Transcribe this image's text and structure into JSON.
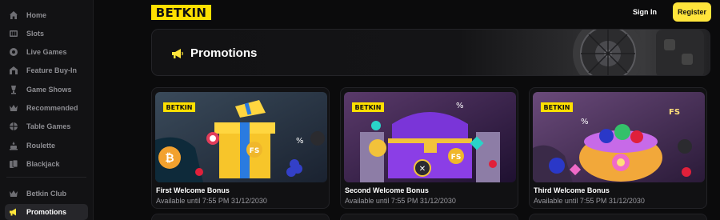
{
  "brand": {
    "logo_text": "BETKIN",
    "accent": "#ffe53b"
  },
  "header": {
    "signin_label": "Sign In",
    "register_label": "Register"
  },
  "sidebar": {
    "items": [
      {
        "label": "Home",
        "icon": "home-icon",
        "active": false
      },
      {
        "label": "Slots",
        "icon": "slots-icon",
        "active": false
      },
      {
        "label": "Live Games",
        "icon": "live-games-icon",
        "active": false
      },
      {
        "label": "Feature Buy-In",
        "icon": "feature-buy-in-icon",
        "active": false
      },
      {
        "label": "Game Shows",
        "icon": "game-shows-icon",
        "active": false
      },
      {
        "label": "Recommended",
        "icon": "crown-icon",
        "active": false
      },
      {
        "label": "Table Games",
        "icon": "table-games-icon",
        "active": false
      },
      {
        "label": "Roulette",
        "icon": "roulette-icon",
        "active": false
      },
      {
        "label": "Blackjack",
        "icon": "blackjack-icon",
        "active": false
      },
      {
        "label": "Betkin Club",
        "icon": "club-icon",
        "active": false
      },
      {
        "label": "Promotions",
        "icon": "megaphone-icon",
        "active": true
      }
    ]
  },
  "main": {
    "banner_title": "Promotions",
    "cards": [
      {
        "title": "First Welcome Bonus",
        "subtitle": "Available until 7:55 PM 31/12/2030",
        "badge": "BETKIN"
      },
      {
        "title": "Second Welcome Bonus",
        "subtitle": "Available until 7:55 PM 31/12/2030",
        "badge": "BETKIN"
      },
      {
        "title": "Third Welcome Bonus",
        "subtitle": "Available until 7:55 PM 31/12/2030",
        "badge": "BETKIN"
      }
    ]
  }
}
